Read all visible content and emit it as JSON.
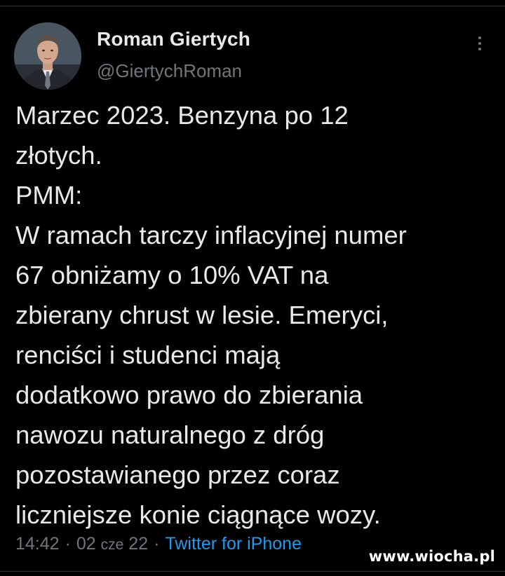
{
  "author": {
    "name": "Roman Giertych",
    "handle": "@GiertychRoman"
  },
  "tweet": {
    "lines": [
      "Marzec 2023. Benzyna po 12",
      "złotych.",
      "PMM:",
      "W ramach tarczy inflacyjnej numer",
      "67 obniżamy o 10% VAT na",
      "zbierany chrust w lesie. Emeryci,",
      "renciści i studenci mają",
      "dodatkowo prawo do zbierania",
      "nawozu naturalnego z dróg",
      "pozostawianego przez coraz",
      "liczniejsze konie ciągnące wozy."
    ]
  },
  "meta": {
    "time": "14:42",
    "separator": "·",
    "date_day": "02",
    "date_month": "cze",
    "date_year": "22",
    "source": "Twitter for iPhone"
  },
  "watermark": "www.wiocha.pl",
  "icons": {
    "more": "more-vertical-icon",
    "avatar": "profile-photo"
  },
  "colors": {
    "background": "#000000",
    "text": "#e7e9ea",
    "secondary": "#71767b",
    "link": "#1d9bf0"
  }
}
